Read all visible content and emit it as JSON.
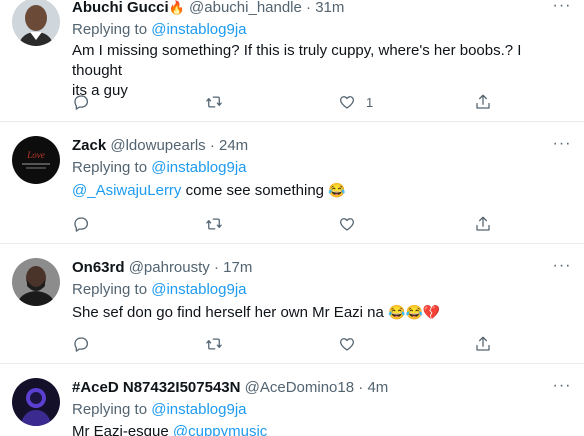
{
  "tweets": [
    {
      "name": "Abuchi Gucci",
      "name_emoji": "🔥",
      "handle": "@abuchi_handle",
      "sep": "·",
      "time": "31m",
      "replying_prefix": "Replying to ",
      "replying_to": "@instablog9ja",
      "text_line1": "Am I missing something? If this is truly cuppy, where's her boobs.? I thought",
      "text_line2": "its a guy",
      "like_count": "1"
    },
    {
      "name": "Zack",
      "handle": "@ldowupearls",
      "sep": "·",
      "time": "24m",
      "replying_prefix": "Replying to ",
      "replying_to": "@instablog9ja",
      "text_mention": "@_AsiwajuLerry",
      "text": " come see something ",
      "emoji": "😂"
    },
    {
      "name": "On63rd",
      "handle": "@pahrousty",
      "sep": "·",
      "time": "17m",
      "replying_prefix": "Replying to ",
      "replying_to": "@instablog9ja",
      "text": "She sef don go find herself her own Mr Eazi na ",
      "emoji": "😂😂💔"
    },
    {
      "name": "#AceD N87432I507543N",
      "handle": "@AceDomino18",
      "sep": "·",
      "time": "4m",
      "replying_prefix": "Replying to ",
      "replying_to": "@instablog9ja",
      "text": "Mr Eazi-esque ",
      "text_mention": "@cuppymusic"
    }
  ],
  "colors": {
    "accent": "#1d9bf0",
    "secondary_text": "#536471",
    "primary_text": "#0f1419",
    "divider": "#e6ecf0"
  },
  "icons": [
    "reply-icon",
    "retweet-icon",
    "like-icon",
    "share-icon",
    "more-icon"
  ]
}
